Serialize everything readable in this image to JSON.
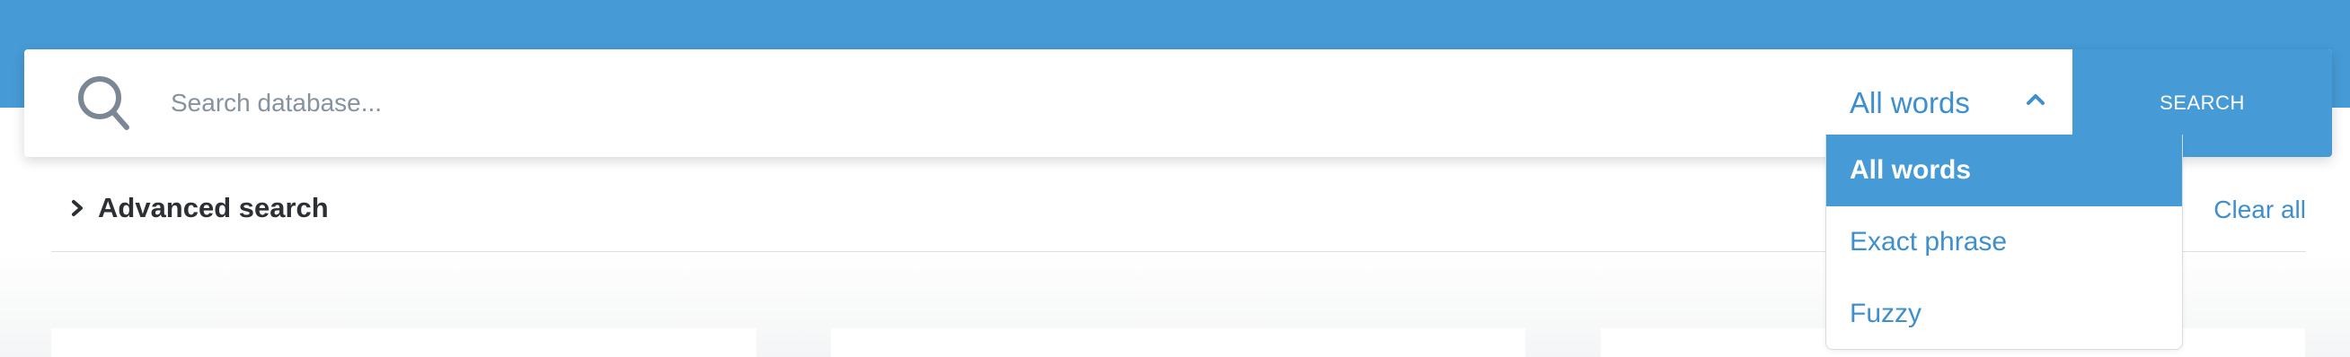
{
  "search": {
    "placeholder": "Search database...",
    "value": ""
  },
  "mode": {
    "selected_label": "All words",
    "options": [
      {
        "label": "All words",
        "selected": true
      },
      {
        "label": "Exact phrase",
        "selected": false
      },
      {
        "label": "Fuzzy",
        "selected": false
      }
    ]
  },
  "toolbar": {
    "search_button_label": "SEARCH"
  },
  "advanced": {
    "label": "Advanced search",
    "clear_all_label": "Clear all"
  },
  "icons": {
    "search": "search-icon",
    "mode_toggle": "chevron-up-icon",
    "advanced_toggle": "chevron-right-icon"
  },
  "colors": {
    "brand_blue": "#469bd6",
    "link_blue": "#3d8fce",
    "placeholder_gray": "#8592a0",
    "icon_gray": "#7b8794",
    "heading_dark": "#2c2f33"
  }
}
